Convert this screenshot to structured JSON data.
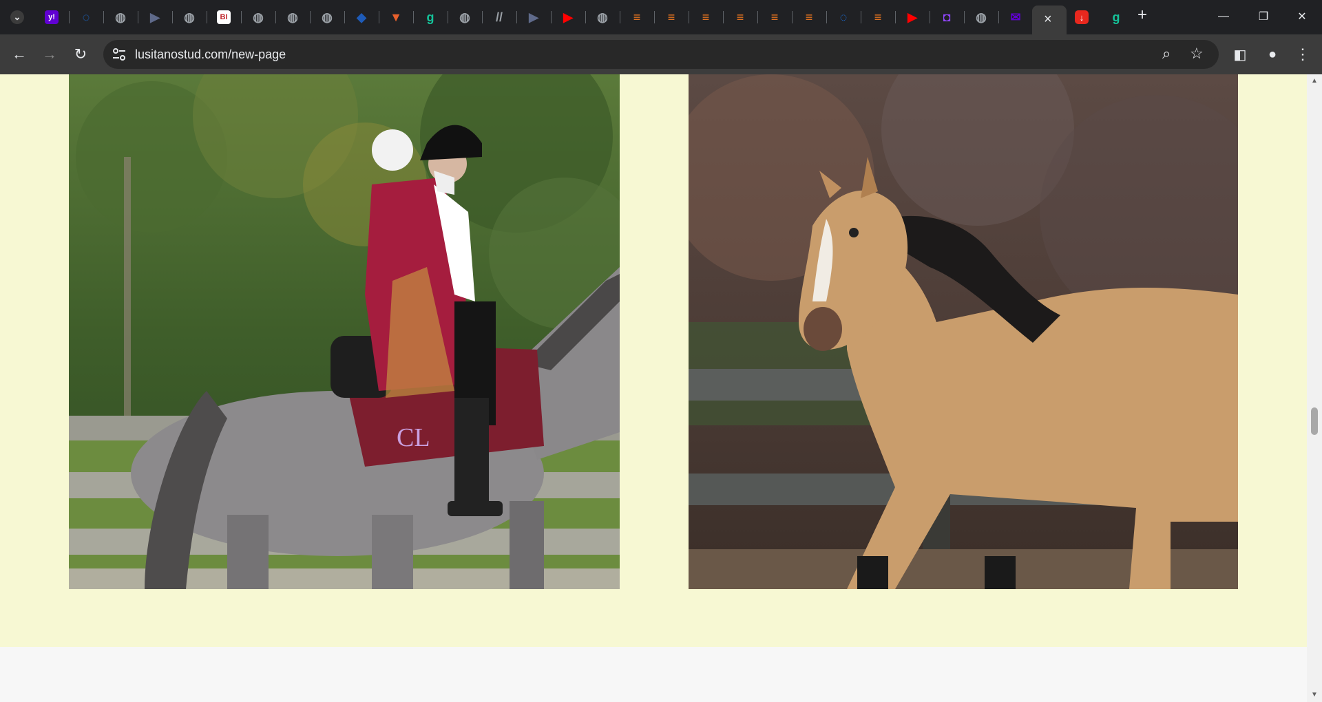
{
  "browser": {
    "tabs": [
      {
        "icon": "tab-search-icon",
        "glyph": "⌄",
        "color": "#3c3c3c"
      },
      {
        "icon": "yahoo-icon",
        "glyph": "y!",
        "color": "#6001d2"
      },
      {
        "icon": "malwarebytes-icon",
        "glyph": "◌",
        "color": "#1a73e8"
      },
      {
        "icon": "globe-icon",
        "glyph": "◍",
        "color": "#9aa0a6"
      },
      {
        "icon": "grey-arrow-icon",
        "glyph": "▶",
        "color": "#5f6a8a"
      },
      {
        "icon": "globe-icon",
        "glyph": "◍",
        "color": "#9aa0a6"
      },
      {
        "icon": "business-insider-icon",
        "glyph": "BI",
        "color": "#ffffff"
      },
      {
        "icon": "globe-icon",
        "glyph": "◍",
        "color": "#9aa0a6"
      },
      {
        "icon": "globe-icon",
        "glyph": "◍",
        "color": "#9aa0a6"
      },
      {
        "icon": "globe-icon",
        "glyph": "◍",
        "color": "#9aa0a6"
      },
      {
        "icon": "cube-icon",
        "glyph": "◆",
        "color": "#1e5bb8"
      },
      {
        "icon": "shield-icon",
        "glyph": "▼",
        "color": "#e8602c"
      },
      {
        "icon": "grammarly-icon",
        "glyph": "g",
        "color": "#15c39a"
      },
      {
        "icon": "globe-icon",
        "glyph": "◍",
        "color": "#9aa0a6"
      },
      {
        "icon": "slash-icon",
        "glyph": "//",
        "color": "#9aa0a6"
      },
      {
        "icon": "grey-arrow-icon",
        "glyph": "▶",
        "color": "#5f6a8a"
      },
      {
        "icon": "youtube-icon",
        "glyph": "▶",
        "color": "#ff0000"
      },
      {
        "icon": "globe-icon",
        "glyph": "◍",
        "color": "#9aa0a6"
      },
      {
        "icon": "bookmark-orange-icon",
        "glyph": "≡",
        "color": "#f47b20"
      },
      {
        "icon": "bookmark-orange-icon",
        "glyph": "≡",
        "color": "#f47b20"
      },
      {
        "icon": "bookmark-orange-icon",
        "glyph": "≡",
        "color": "#f47b20"
      },
      {
        "icon": "bookmark-orange-icon",
        "glyph": "≡",
        "color": "#f47b20"
      },
      {
        "icon": "bookmark-orange-icon",
        "glyph": "≡",
        "color": "#f47b20"
      },
      {
        "icon": "bookmark-orange-icon",
        "glyph": "≡",
        "color": "#f47b20"
      },
      {
        "icon": "malwarebytes-icon",
        "glyph": "◌",
        "color": "#1a73e8"
      },
      {
        "icon": "bookmark-orange-icon",
        "glyph": "≡",
        "color": "#f47b20"
      },
      {
        "icon": "youtube-icon",
        "glyph": "▶",
        "color": "#ff0000"
      },
      {
        "icon": "twitch-icon",
        "glyph": "◘",
        "color": "#9146ff"
      },
      {
        "icon": "globe-icon",
        "glyph": "◍",
        "color": "#9aa0a6"
      },
      {
        "icon": "yahoo-mail-icon",
        "glyph": "✉",
        "color": "#6001d2"
      }
    ],
    "active_tab_close": "×",
    "after_tabs": [
      {
        "icon": "download-red-icon",
        "glyph": "↓",
        "color": "#e8281e"
      },
      {
        "icon": "grammarly-icon",
        "glyph": "g",
        "color": "#15c39a"
      }
    ],
    "new_tab": "+",
    "minimize": "—",
    "restore": "❐",
    "close": "✕",
    "back": "←",
    "forward": "→",
    "reload": "↻",
    "url": "lusitanostud.com/new-page",
    "zoom": "⌕",
    "star": "☆",
    "sidepanel": "◧",
    "profile": "●",
    "menu": "⋮"
  },
  "page": {
    "background": "#f7f8d3",
    "images": [
      {
        "alt": "Rider in red baroque costume and tricorn hat on a grey horse"
      },
      {
        "alt": "Buckskin horse with black mane trotting by a wooden fence"
      }
    ]
  }
}
